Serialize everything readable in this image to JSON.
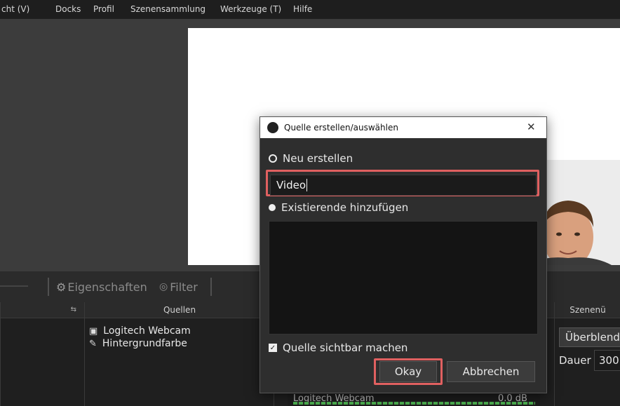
{
  "menu": {
    "items": [
      "cht (V)",
      "Docks",
      "Profil",
      "Szenensammlung",
      "Werkzeuge (T)",
      "Hilfe"
    ]
  },
  "toolbar": {
    "properties_label": "Eigenschaften",
    "filter_label": "Filter"
  },
  "panels": {
    "sources_title": "Quellen",
    "transitions_title": "Szenenü",
    "sources": [
      {
        "label": "Logitech Webcam",
        "icon": "camera-icon"
      },
      {
        "label": "Hintergrundfarbe",
        "icon": "brush-icon"
      }
    ],
    "transition_select": "Überblend",
    "duration_label": "Dauer",
    "duration_value": "300"
  },
  "mixer": {
    "label": "Logitech Webcam",
    "db": "0.0 dB"
  },
  "dialog": {
    "title": "Quelle erstellen/auswählen",
    "close": "✕",
    "create_new_label": "Neu erstellen",
    "name_value": "Video",
    "add_existing_label": "Existierende hinzufügen",
    "visible_label": "Quelle sichtbar machen",
    "ok_label": "Okay",
    "cancel_label": "Abbrechen"
  },
  "colors": {
    "highlight": "#e06060"
  }
}
